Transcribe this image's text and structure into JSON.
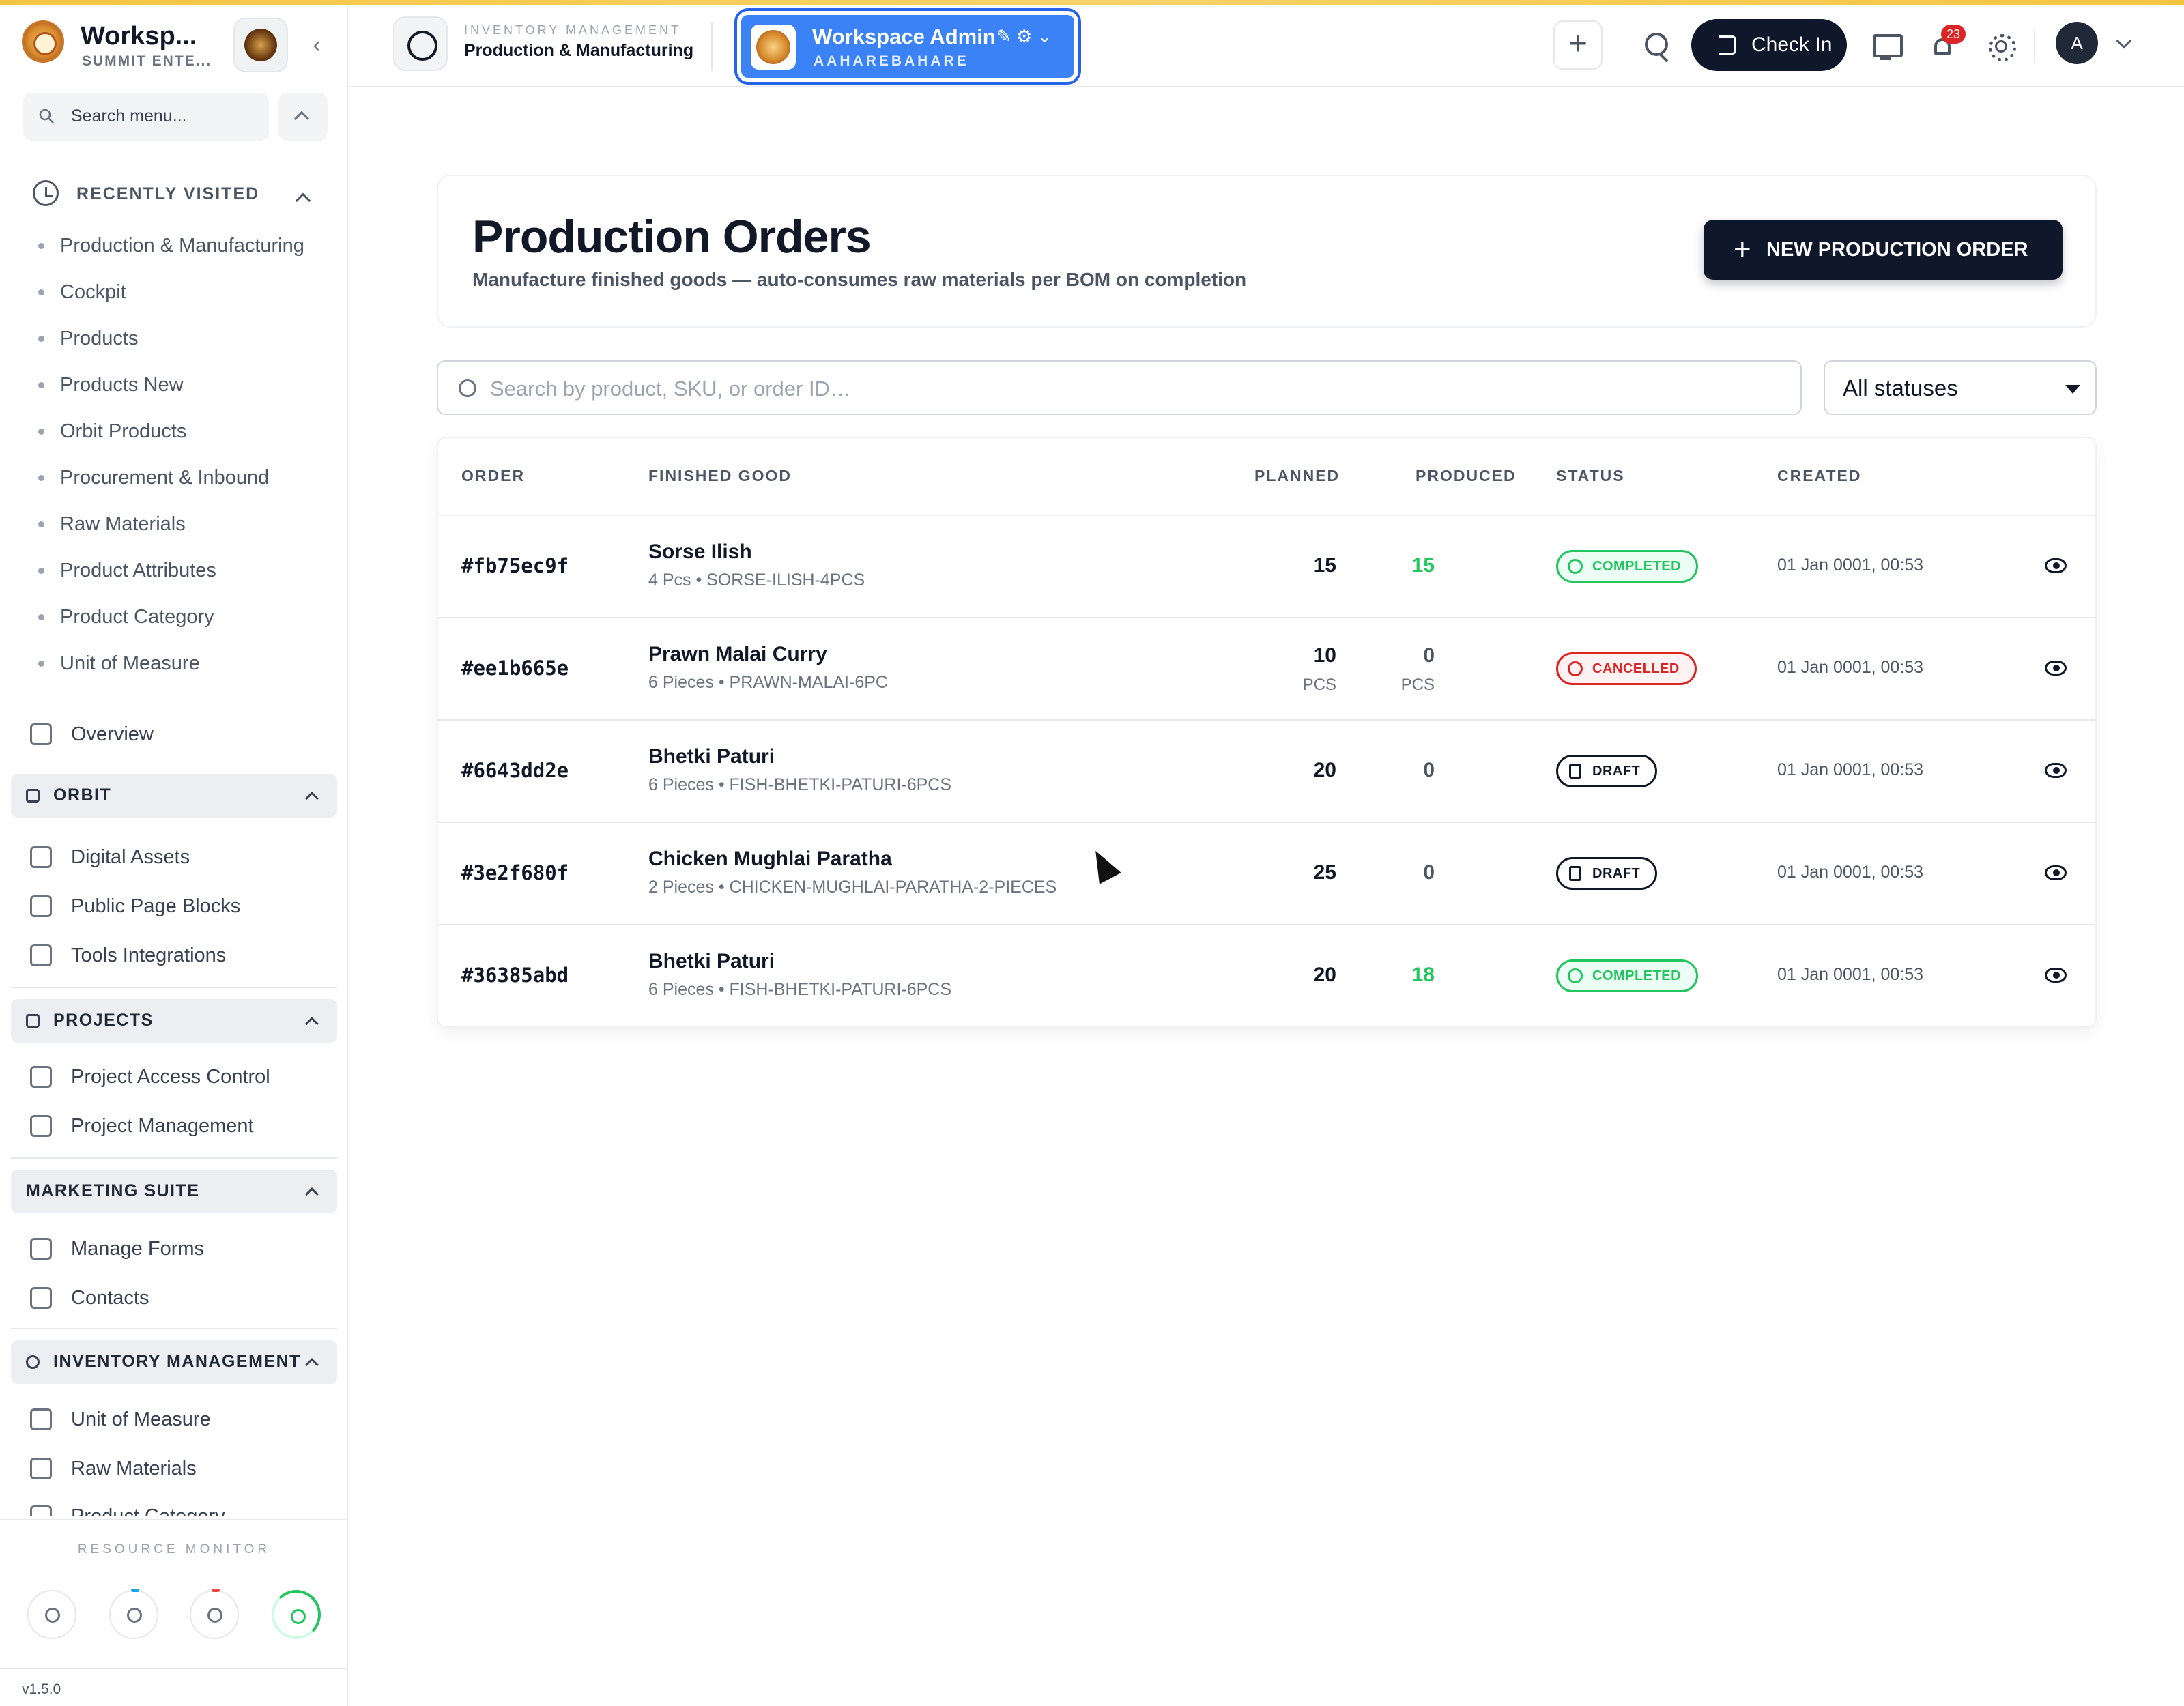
{
  "sidebar": {
    "workspace_name": "Worksp...",
    "workspace_sub": "SUMMIT ENTE...",
    "search_placeholder": "Search menu...",
    "recently_visited_title": "RECENTLY VISITED",
    "recently_visited": [
      "Production & Manufacturing",
      "Cockpit",
      "Products",
      "Products New",
      "Orbit Products",
      "Procurement & Inbound",
      "Raw Materials",
      "Product Attributes",
      "Product Category",
      "Unit of Measure"
    ],
    "overview": "Overview",
    "groups": [
      {
        "title": "ORBIT",
        "items": [
          "Digital Assets",
          "Public Page Blocks",
          "Tools Integrations"
        ]
      },
      {
        "title": "PROJECTS",
        "items": [
          "Project Access Control",
          "Project Management"
        ]
      },
      {
        "title": "MARKETING SUITE",
        "items": [
          "Manage Forms",
          "Contacts"
        ]
      },
      {
        "title": "INVENTORY MANAGEMENT",
        "items": [
          "Unit of Measure",
          "Raw Materials",
          "Product Category"
        ]
      }
    ],
    "resource_monitor_title": "RESOURCE MONITOR",
    "version": "v1.5.0"
  },
  "topbar": {
    "module_label": "INVENTORY MANAGEMENT",
    "module_title": "Production & Manufacturing",
    "workspace_pill_title": "Workspace Admin",
    "workspace_pill_sub": "AAHAREBAHARE",
    "checkin_label": "Check In",
    "notification_count": "23",
    "user_initial": "A"
  },
  "page": {
    "title": "Production Orders",
    "subtitle": "Manufacture finished goods — auto-consumes raw materials per BOM on completion",
    "new_button": "NEW PRODUCTION ORDER",
    "search_placeholder": "Search by product, SKU, or order ID…",
    "status_filter": "All statuses"
  },
  "table": {
    "headers": {
      "order": "ORDER",
      "finished_good": "FINISHED GOOD",
      "planned": "PLANNED",
      "produced": "PRODUCED",
      "status": "STATUS",
      "created": "CREATED"
    },
    "rows": [
      {
        "order": "#fb75ec9f",
        "name": "Sorse Ilish",
        "meta": "4 Pcs • SORSE-ILISH-4PCS",
        "planned": "15",
        "planned_unit": "",
        "produced": "15",
        "produced_unit": "",
        "status": "COMPLETED",
        "created": "01 Jan 0001, 00:53"
      },
      {
        "order": "#ee1b665e",
        "name": "Prawn Malai Curry",
        "meta": "6 Pieces • PRAWN-MALAI-6PC",
        "planned": "10",
        "planned_unit": "PCS",
        "produced": "0",
        "produced_unit": "PCS",
        "status": "CANCELLED",
        "created": "01 Jan 0001, 00:53"
      },
      {
        "order": "#6643dd2e",
        "name": "Bhetki Paturi",
        "meta": "6 Pieces • FISH-BHETKI-PATURI-6PCS",
        "planned": "20",
        "planned_unit": "",
        "produced": "0",
        "produced_unit": "",
        "status": "DRAFT",
        "created": "01 Jan 0001, 00:53"
      },
      {
        "order": "#3e2f680f",
        "name": "Chicken Mughlai Paratha",
        "meta": "2 Pieces • CHICKEN-MUGHLAI-PARATHA-2-PIECES",
        "planned": "25",
        "planned_unit": "",
        "produced": "0",
        "produced_unit": "",
        "status": "DRAFT",
        "created": "01 Jan 0001, 00:53"
      },
      {
        "order": "#36385abd",
        "name": "Bhetki Paturi",
        "meta": "6 Pieces • FISH-BHETKI-PATURI-6PCS",
        "planned": "20",
        "planned_unit": "",
        "produced": "18",
        "produced_unit": "",
        "status": "COMPLETED",
        "created": "01 Jan 0001, 00:53"
      }
    ]
  },
  "colors": {
    "accent": "#3b82f6",
    "dark": "#0f172a",
    "completed": "#22c55e",
    "cancelled": "#dc2626",
    "draft": "#111827",
    "produced_zero": "#4b5563"
  }
}
